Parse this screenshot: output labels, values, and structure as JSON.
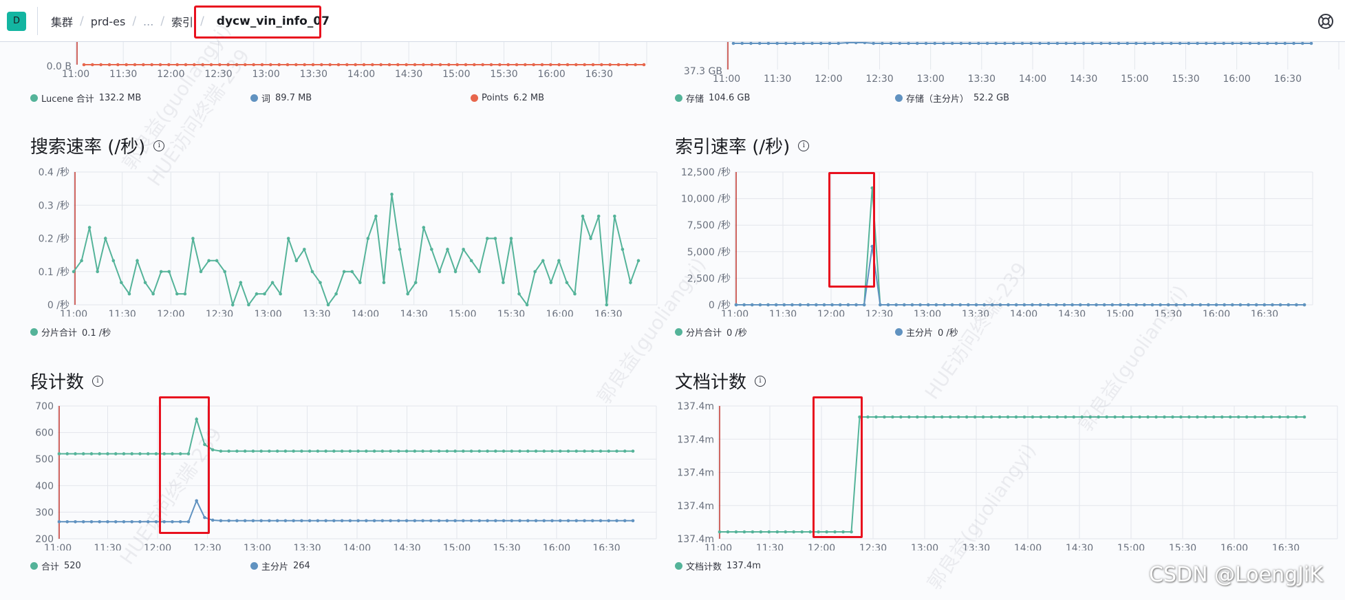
{
  "app": {
    "badge": "D"
  },
  "breadcrumb": {
    "items": [
      "集群",
      "prd-es",
      "...",
      "索引"
    ],
    "current": "dycw_vin_info_07"
  },
  "panels": {
    "top_left": {
      "last_y_label": "0.0 B",
      "legend": [
        {
          "name": "Lucene 合计",
          "value": "132.2 MB",
          "color": "#54b399"
        },
        {
          "name": "词",
          "value": "89.7 MB",
          "color": "#6092c0"
        },
        {
          "name": "Points",
          "value": "6.2 MB",
          "color": "#e7664c"
        }
      ]
    },
    "top_right": {
      "last_y_label": "37.3 GB",
      "legend": [
        {
          "name": "存储",
          "value": "104.6 GB",
          "color": "#54b399"
        },
        {
          "name": "存储（主分片）",
          "value": "52.2 GB",
          "color": "#6092c0"
        }
      ]
    },
    "search_rate": {
      "title": "搜索速率 (/秒)",
      "legend": [
        {
          "name": "分片合计",
          "value": "0.1 /秒",
          "color": "#54b399"
        }
      ]
    },
    "index_rate": {
      "title": "索引速率 (/秒)",
      "legend": [
        {
          "name": "分片合计",
          "value": "0 /秒",
          "color": "#54b399"
        },
        {
          "name": "主分片",
          "value": "0 /秒",
          "color": "#6092c0"
        }
      ]
    },
    "segment_count": {
      "title": "段计数",
      "legend": [
        {
          "name": "合计",
          "value": "520",
          "color": "#54b399"
        },
        {
          "name": "主分片",
          "value": "264",
          "color": "#6092c0"
        }
      ]
    },
    "doc_count": {
      "title": "文档计数",
      "legend": [
        {
          "name": "文档计数",
          "value": "137.4m",
          "color": "#54b399"
        }
      ]
    }
  },
  "chart_data": [
    {
      "type": "line",
      "name": "top-left-storage-partial",
      "x_ticks": [
        "11:00",
        "11:30",
        "12:00",
        "12:30",
        "13:00",
        "13:30",
        "14:00",
        "14:30",
        "15:00",
        "15:30",
        "16:00",
        "16:30"
      ],
      "y_ticks": [
        "0.0 B"
      ],
      "series": [
        {
          "name": "Points",
          "color": "#e7664c",
          "values": [
            0,
            0,
            0,
            0,
            0,
            0,
            0,
            0,
            0,
            0,
            0,
            0,
            0,
            0,
            0,
            0,
            0,
            0,
            0,
            0,
            0,
            0,
            0,
            0,
            0,
            0,
            0,
            0,
            0,
            0,
            0,
            0,
            0,
            0,
            0,
            0,
            0,
            0,
            0,
            0,
            0,
            0,
            0,
            0,
            0,
            0,
            0,
            0,
            0,
            0,
            0,
            0,
            0,
            0,
            0,
            0,
            0,
            0,
            0,
            0,
            0,
            0,
            0,
            0,
            0,
            0,
            0
          ]
        }
      ]
    },
    {
      "type": "line",
      "name": "top-right-storage-partial",
      "x_ticks": [
        "11:00",
        "11:30",
        "12:00",
        "12:30",
        "13:00",
        "13:30",
        "14:00",
        "14:30",
        "15:00",
        "15:30",
        "16:00",
        "16:30"
      ],
      "y_ticks": [
        "37.3 GB"
      ],
      "series": [
        {
          "name": "存储（主分片）",
          "color": "#6092c0",
          "values": [
            0,
            0,
            0,
            0,
            0,
            0,
            0,
            0,
            0,
            0,
            0,
            0,
            0,
            0,
            0,
            0,
            0,
            0,
            0,
            0,
            0,
            0,
            0,
            0,
            0,
            0,
            0,
            0,
            0,
            0,
            0,
            0,
            0,
            0,
            0,
            0,
            0,
            0,
            0,
            0,
            0,
            0,
            0,
            0,
            0,
            0,
            0,
            0,
            0,
            0,
            0,
            0,
            0,
            0,
            0,
            0,
            0,
            0,
            0,
            0,
            0,
            0,
            0,
            0,
            0,
            0,
            0
          ]
        }
      ]
    },
    {
      "type": "line",
      "name": "search-rate",
      "title": "搜索速率 (/秒)",
      "x_ticks": [
        "11:00",
        "11:30",
        "12:00",
        "12:30",
        "13:00",
        "13:30",
        "14:00",
        "14:30",
        "15:00",
        "15:30",
        "16:00",
        "16:30"
      ],
      "y_ticks": [
        "0 /秒",
        "0.1 /秒",
        "0.2 /秒",
        "0.3 /秒",
        "0.4 /秒"
      ],
      "ylim": [
        0,
        0.4
      ],
      "series": [
        {
          "name": "分片合计",
          "color": "#54b399",
          "values": [
            0.1,
            0.133,
            0.233,
            0.1,
            0.2,
            0.133,
            0.067,
            0.033,
            0.133,
            0.067,
            0.033,
            0.1,
            0.1,
            0.033,
            0.033,
            0.2,
            0.1,
            0.133,
            0.133,
            0.1,
            0,
            0.067,
            0,
            0.033,
            0.033,
            0.067,
            0.033,
            0.2,
            0.133,
            0.167,
            0.1,
            0.067,
            0,
            0.033,
            0.1,
            0.1,
            0.067,
            0.2,
            0.267,
            0.067,
            0.333,
            0.167,
            0.033,
            0.067,
            0.233,
            0.167,
            0.1,
            0.167,
            0.1,
            0.167,
            0.133,
            0.1,
            0.2,
            0.2,
            0.067,
            0.2,
            0.033,
            0,
            0.1,
            0.133,
            0.067,
            0.133,
            0.067,
            0.033,
            0.267,
            0.2,
            0.267,
            0,
            0.267,
            0.167,
            0.067,
            0.133
          ]
        }
      ]
    },
    {
      "type": "line",
      "name": "index-rate",
      "title": "索引速率 (/秒)",
      "x_ticks": [
        "11:00",
        "11:30",
        "12:00",
        "12:30",
        "13:00",
        "13:30",
        "14:00",
        "14:30",
        "15:00",
        "15:30",
        "16:00",
        "16:30"
      ],
      "y_ticks": [
        "0 /秒",
        "2,500 /秒",
        "5,000 /秒",
        "7,500 /秒",
        "10,000 /秒",
        "12,500 /秒"
      ],
      "ylim": [
        0,
        12500
      ],
      "series": [
        {
          "name": "分片合计",
          "color": "#54b399",
          "peak_index": 17,
          "peak_value": 11000,
          "count": 72
        },
        {
          "name": "主分片",
          "color": "#6092c0",
          "peak_index": 17,
          "peak_value": 5500,
          "count": 72
        }
      ]
    },
    {
      "type": "line",
      "name": "segment-count",
      "title": "段计数",
      "x_ticks": [
        "11:00",
        "11:30",
        "12:00",
        "12:30",
        "13:00",
        "13:30",
        "14:00",
        "14:30",
        "15:00",
        "15:30",
        "16:00",
        "16:30"
      ],
      "y_ticks": [
        "200",
        "300",
        "400",
        "500",
        "600",
        "700"
      ],
      "ylim": [
        200,
        700
      ],
      "series": [
        {
          "name": "合计",
          "color": "#54b399",
          "base": 520,
          "after": 530,
          "spike": [
            650,
            555,
            535
          ],
          "spike_start": 17,
          "count": 72
        },
        {
          "name": "主分片",
          "color": "#6092c0",
          "base": 264,
          "after": 268,
          "spike": [
            343,
            280,
            270
          ],
          "spike_start": 17,
          "count": 72
        }
      ]
    },
    {
      "type": "line",
      "name": "doc-count",
      "title": "文档计数",
      "x_ticks": [
        "11:00",
        "11:30",
        "12:00",
        "12:30",
        "13:00",
        "13:30",
        "14:00",
        "14:30",
        "15:00",
        "15:30",
        "16:00",
        "16:30"
      ],
      "y_ticks": [
        "137.4m",
        "137.4m",
        "137.4m",
        "137.4m",
        "137.4m"
      ],
      "series": [
        {
          "name": "文档计数",
          "color": "#54b399",
          "step_index": 16,
          "count": 72
        }
      ]
    }
  ],
  "watermark": {
    "text_1": "郭良益(guoliangyi)",
    "text_2": "HUE访问终端-239"
  },
  "footer_watermark": "CSDN @LoengJiK"
}
